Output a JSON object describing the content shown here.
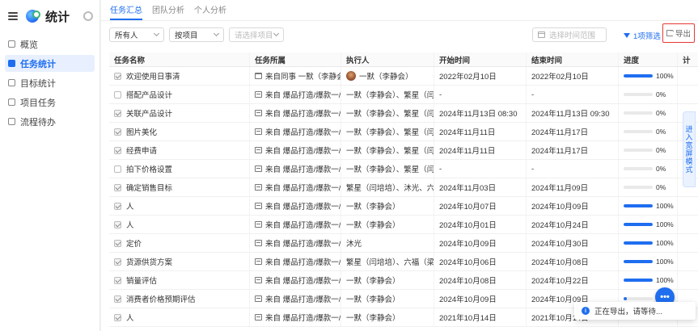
{
  "sidebar": {
    "title": "统计",
    "items": [
      {
        "label": "概览",
        "active": false
      },
      {
        "label": "任务统计",
        "active": true
      },
      {
        "label": "目标统计",
        "active": false
      },
      {
        "label": "项目任务",
        "active": false
      },
      {
        "label": "流程待办",
        "active": false
      }
    ]
  },
  "tabs": [
    {
      "label": "任务汇总",
      "active": true
    },
    {
      "label": "团队分析",
      "active": false
    },
    {
      "label": "个人分析",
      "active": false
    }
  ],
  "filters": {
    "owner": "所有人",
    "group_by": "按项目",
    "project_placeholder": "请选择项目",
    "date_placeholder": "选择时间范围",
    "filter_label": "1项筛选",
    "export_label": "导出"
  },
  "table": {
    "headers": [
      "任务名称",
      "任务所属",
      "执行人",
      "开始时间",
      "结束时间",
      "进度",
      "计"
    ],
    "rows": [
      {
        "name": "欢迎使用日事清",
        "checked": true,
        "belong": "来自同事 一默（李静会）",
        "belong_icon": "calendar-icon",
        "exec": "一默（李静会）",
        "avatar": true,
        "start": "2022年02月10日",
        "end": "2022年02月10日",
        "progress": 100,
        "pct": "100%"
      },
      {
        "name": "搭配产品设计",
        "checked": false,
        "belong": "来自 爆品打造/爆款一/筹...",
        "belong_icon": "project-icon",
        "exec": "一默（李静会）、繁星（闫培培）",
        "avatar": false,
        "start": "-",
        "end": "-",
        "progress": 0,
        "pct": "0%"
      },
      {
        "name": "关联产品设计",
        "checked": true,
        "belong": "来自 爆品打造/爆款一/筹...",
        "belong_icon": "project-icon",
        "exec": "一默（李静会）、繁星（闫培培）",
        "avatar": false,
        "start": "2024年11月13日 08:30",
        "end": "2024年11月13日 09:30",
        "progress": 0,
        "pct": "0%"
      },
      {
        "name": "图片美化",
        "checked": true,
        "belong": "来自 爆品打造/爆款一/筹...",
        "belong_icon": "project-icon",
        "exec": "一默（李静会）、繁星（闫培培）",
        "avatar": false,
        "start": "2024年11月11日",
        "end": "2024年11月17日",
        "progress": 0,
        "pct": "0%"
      },
      {
        "name": "经费申请",
        "checked": true,
        "belong": "来自 爆品打造/爆款一/筹...",
        "belong_icon": "project-icon",
        "exec": "一默（李静会）、繁星（闫培培）",
        "avatar": false,
        "start": "2024年11月11日",
        "end": "2024年11月17日",
        "progress": 0,
        "pct": "0%"
      },
      {
        "name": "拍下价格设置",
        "checked": false,
        "belong": "来自 爆品打造/爆款一/筹...",
        "belong_icon": "project-icon",
        "exec": "一默（李静会）、繁星（闫培培）",
        "avatar": false,
        "start": "-",
        "end": "-",
        "progress": 0,
        "pct": "0%"
      },
      {
        "name": "确定销售目标",
        "checked": true,
        "belong": "来自 爆品打造/爆款一/筹...",
        "belong_icon": "project-icon",
        "exec": "繁星（闫培培）、沐光、六福...",
        "avatar": false,
        "start": "2024年11月03日",
        "end": "2024年11月09日",
        "progress": 0,
        "pct": "0%"
      },
      {
        "name": "人",
        "checked": true,
        "belong": "来自 爆品打造/爆款一/前...",
        "belong_icon": "project-icon",
        "exec": "一默（李静会）",
        "avatar": false,
        "start": "2024年10月07日",
        "end": "2024年10月09日",
        "progress": 100,
        "pct": "100%"
      },
      {
        "name": "人",
        "checked": true,
        "belong": "来自 爆品打造/爆款一/前...",
        "belong_icon": "project-icon",
        "exec": "一默（李静会）",
        "avatar": false,
        "start": "2024年10月01日",
        "end": "2024年10月24日",
        "progress": 100,
        "pct": "100%"
      },
      {
        "name": "定价",
        "checked": true,
        "belong": "来自 爆品打造/爆款一/前...",
        "belong_icon": "project-icon",
        "exec": "沐光",
        "avatar": false,
        "start": "2024年10月09日",
        "end": "2024年10月30日",
        "progress": 100,
        "pct": "100%"
      },
      {
        "name": "货源供货方案",
        "checked": true,
        "belong": "来自 爆品打造/爆款一/前...",
        "belong_icon": "project-icon",
        "exec": "繁星（闫培培）、六福（梁海...",
        "avatar": false,
        "start": "2024年10月06日",
        "end": "2024年10月08日",
        "progress": 100,
        "pct": "100%"
      },
      {
        "name": "销量评估",
        "checked": true,
        "belong": "来自 爆品打造/爆款一/前...",
        "belong_icon": "project-icon",
        "exec": "一默（李静会）",
        "avatar": false,
        "start": "2024年10月08日",
        "end": "2024年10月22日",
        "progress": 100,
        "pct": "100%"
      },
      {
        "name": "消费者价格预期评估",
        "checked": true,
        "belong": "来自 爆品打造/爆款一/前...",
        "belong_icon": "project-icon",
        "exec": "一默（李静会）",
        "avatar": false,
        "start": "2024年10月09日",
        "end": "2024年10月09日",
        "progress": 10,
        "pct": ""
      },
      {
        "name": "人",
        "checked": true,
        "belong": "来自 爆品打造/爆款一/筹...",
        "belong_icon": "project-icon",
        "exec": "一默（李静会）",
        "avatar": false,
        "start": "2021年10月14日",
        "end": "2021年10月14日",
        "progress": 100,
        "pct": ""
      }
    ]
  },
  "float_tab": "进入宽屏模式",
  "fab": "•••",
  "toast": "正在导出，请等待...",
  "colors": {
    "accent": "#1f6ef0",
    "export_outline": "#e53935"
  }
}
